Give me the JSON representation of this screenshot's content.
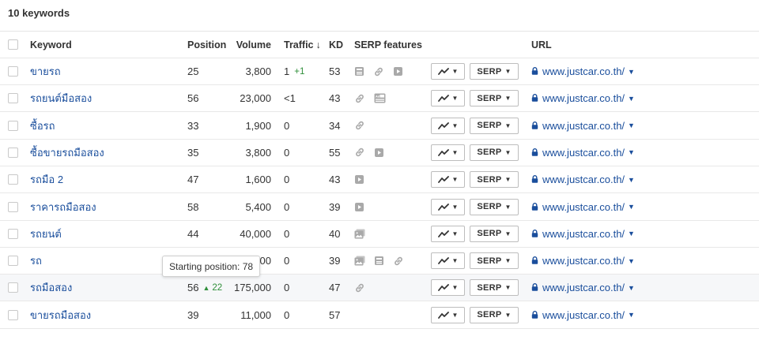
{
  "summary": {
    "title": "10 keywords"
  },
  "columns": {
    "keyword": "Keyword",
    "position": "Position",
    "volume": "Volume",
    "traffic": "Traffic",
    "traffic_sort": "↓",
    "kd": "KD",
    "serp_features": "SERP features",
    "url": "URL"
  },
  "buttons": {
    "serp": "SERP"
  },
  "tooltip": {
    "text": "Starting position: 78"
  },
  "rows": [
    {
      "keyword": "ขายรถ",
      "position": "25",
      "volume": "3,800",
      "traffic": "1",
      "traffic_delta": "+1",
      "kd": "53",
      "features": [
        "image-pack-icon",
        "link-icon",
        "video-icon"
      ],
      "url": "www.justcar.co.th/"
    },
    {
      "keyword": "รถยนต์มือสอง",
      "position": "56",
      "volume": "23,000",
      "traffic": "<1",
      "kd": "43",
      "features": [
        "link-icon",
        "ad-icon"
      ],
      "url": "www.justcar.co.th/"
    },
    {
      "keyword": "ซื้อรถ",
      "position": "33",
      "volume": "1,900",
      "traffic": "0",
      "kd": "34",
      "features": [
        "link-icon"
      ],
      "url": "www.justcar.co.th/"
    },
    {
      "keyword": "ซื้อขายรถมือสอง",
      "position": "35",
      "volume": "3,800",
      "traffic": "0",
      "kd": "55",
      "features": [
        "link-icon",
        "video-icon"
      ],
      "url": "www.justcar.co.th/"
    },
    {
      "keyword": "รถมือ 2",
      "position": "47",
      "volume": "1,600",
      "traffic": "0",
      "kd": "43",
      "features": [
        "video-icon"
      ],
      "url": "www.justcar.co.th/"
    },
    {
      "keyword": "ราคารถมือสอง",
      "position": "58",
      "volume": "5,400",
      "traffic": "0",
      "kd": "39",
      "features": [
        "video-icon"
      ],
      "url": "www.justcar.co.th/"
    },
    {
      "keyword": "รถยนต์",
      "position": "44",
      "volume": "40,000",
      "traffic": "0",
      "kd": "40",
      "features": [
        "images-icon"
      ],
      "url": "www.justcar.co.th/"
    },
    {
      "keyword": "รถ",
      "position": "",
      "volume": "00",
      "traffic": "0",
      "kd": "39",
      "features": [
        "images-icon",
        "image-pack-icon",
        "link-icon"
      ],
      "url": "www.justcar.co.th/"
    },
    {
      "keyword": "รถมือสอง",
      "position": "56",
      "position_delta": "22",
      "volume": "175,000",
      "traffic": "0",
      "kd": "47",
      "features": [
        "link-icon"
      ],
      "url": "www.justcar.co.th/"
    },
    {
      "keyword": "ขายรถมือสอง",
      "position": "39",
      "volume": "11,000",
      "traffic": "0",
      "kd": "57",
      "features": [],
      "url": "www.justcar.co.th/"
    }
  ]
}
